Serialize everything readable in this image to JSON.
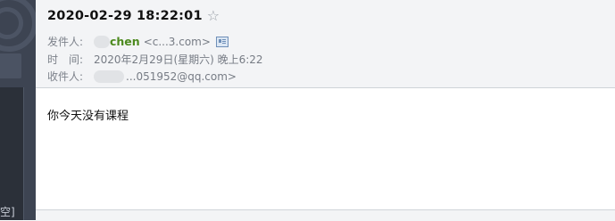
{
  "sidebar": {
    "bottom_text": "空]"
  },
  "mail": {
    "subject": "2020-02-29 18:22:01",
    "star_icon": "star-outline-icon",
    "from_label": "发件人:",
    "from_name": "chen",
    "from_address": "<c...3.com>",
    "address_card_icon": "address-card-icon",
    "time_label": "时　间:",
    "time_value": "2020年2月29日(星期六) 晚上6:22",
    "to_label": "收件人:",
    "to_address": "...051952@qq.com>",
    "body": "你今天没有课程"
  }
}
